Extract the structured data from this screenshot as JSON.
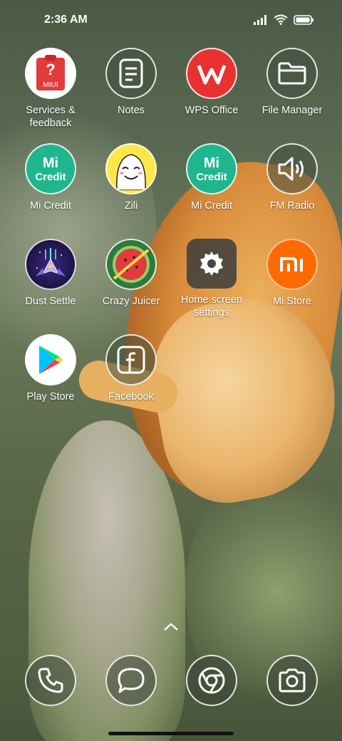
{
  "status_bar": {
    "time": "2:36 AM"
  },
  "apps": [
    {
      "label": "Services &\nfeedback",
      "name": "services-feedback",
      "icon": "miui-services-icon",
      "badge": "MIUI"
    },
    {
      "label": "Notes",
      "name": "notes",
      "icon": "notes-icon"
    },
    {
      "label": "WPS Office",
      "name": "wps-office",
      "icon": "wps-icon"
    },
    {
      "label": "File Manager",
      "name": "file-manager",
      "icon": "folder-icon"
    },
    {
      "label": "Mi Credit",
      "name": "mi-credit-1",
      "icon": "mi-credit-icon",
      "text": "Credit"
    },
    {
      "label": "Zili",
      "name": "zili",
      "icon": "zili-face-icon"
    },
    {
      "label": "Mi Credit",
      "name": "mi-credit-2",
      "icon": "mi-credit-icon",
      "text": "Credit"
    },
    {
      "label": "FM Radio",
      "name": "fm-radio",
      "icon": "speaker-icon"
    },
    {
      "label": "Dust Settle",
      "name": "dust-settle",
      "icon": "spaceship-game-icon"
    },
    {
      "label": "Crazy Juicer",
      "name": "crazy-juicer",
      "icon": "watermelon-icon"
    },
    {
      "label": "Home screen\nsettings",
      "name": "home-screen-settings",
      "icon": "gear-icon"
    },
    {
      "label": "Mi Store",
      "name": "mi-store",
      "icon": "mi-logo-icon",
      "text": "mi"
    },
    {
      "label": "Play Store",
      "name": "play-store",
      "icon": "play-store-icon"
    },
    {
      "label": "Facebook",
      "name": "facebook",
      "icon": "facebook-icon"
    }
  ],
  "dock": [
    {
      "name": "phone",
      "icon": "phone-icon"
    },
    {
      "name": "messages",
      "icon": "message-bubble-icon"
    },
    {
      "name": "browser",
      "icon": "chrome-icon"
    },
    {
      "name": "camera",
      "icon": "camera-icon"
    }
  ],
  "colors": {
    "wps_red": "#e8322f",
    "mi_orange": "#ff6a00",
    "mi_credit_teal": "#1fb68e",
    "zili_yellow": "#ffe64a",
    "label_text": "#ffffff"
  }
}
